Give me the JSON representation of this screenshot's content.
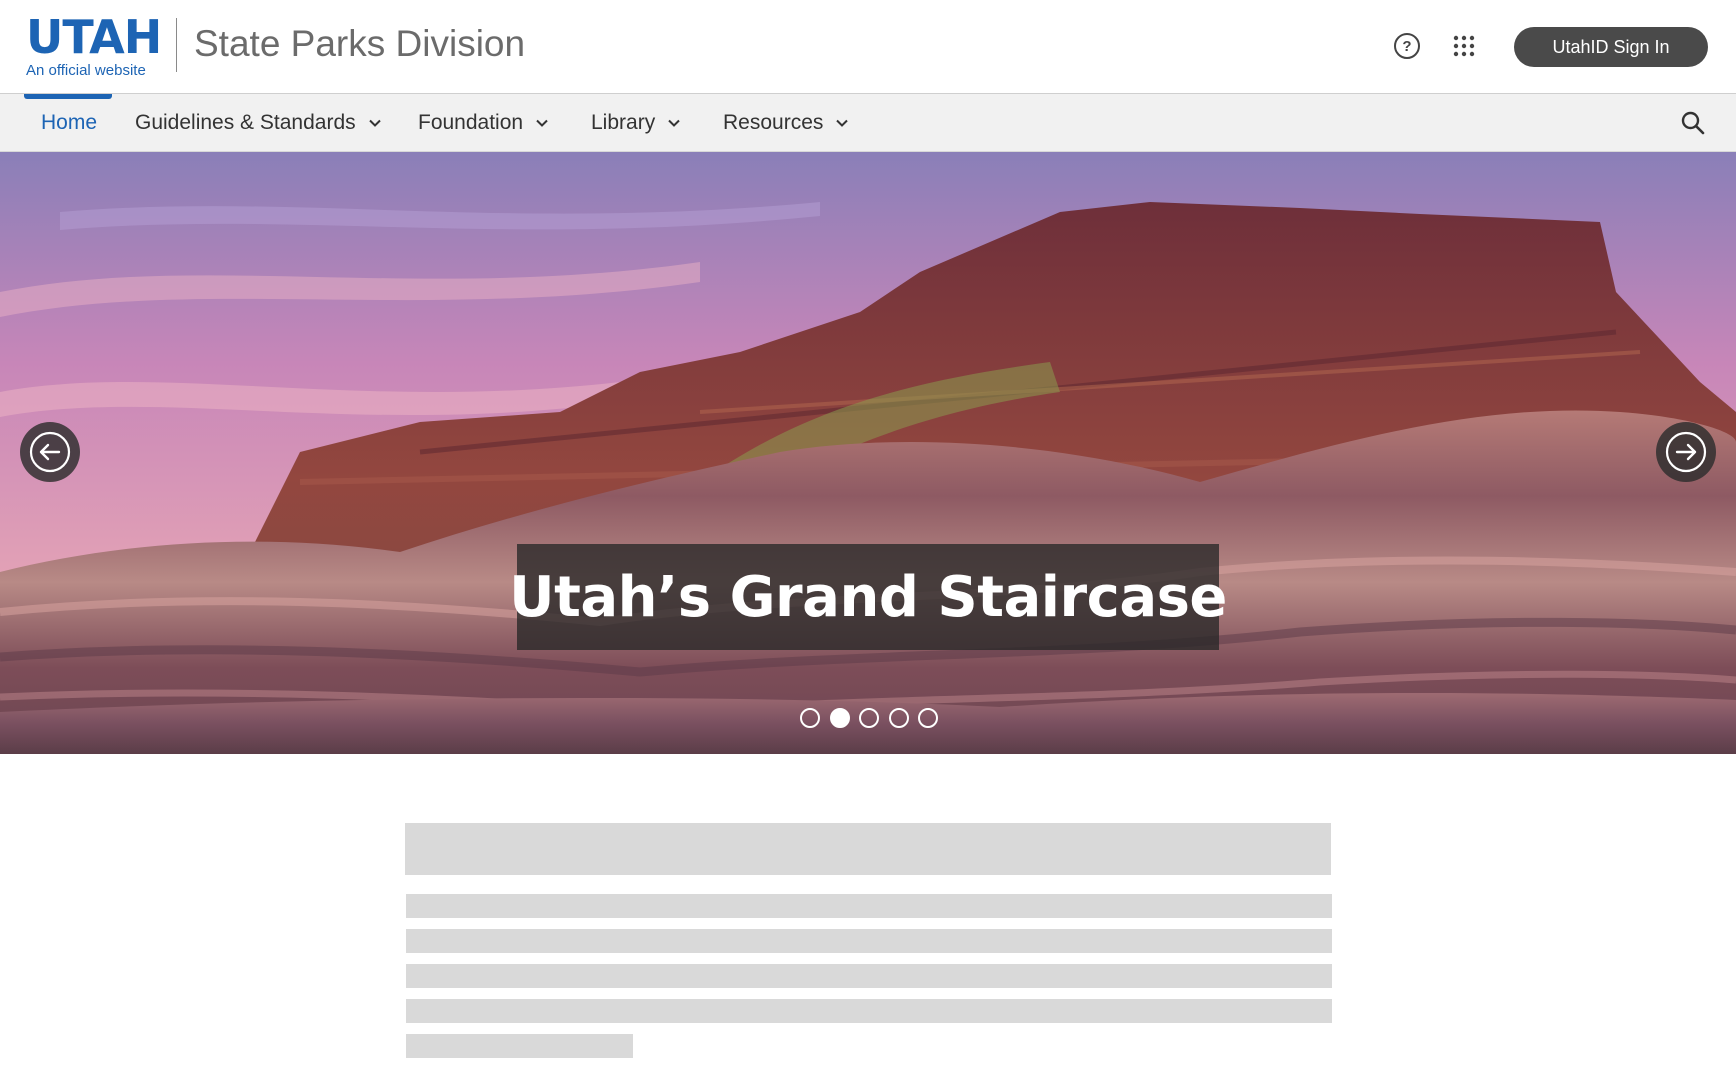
{
  "header": {
    "logo_text": "UTAH",
    "logo_subtitle": "An official website",
    "site_title": "State Parks Division",
    "help_icon": "help-circle-icon",
    "apps_icon": "apps-grid-icon",
    "signin_label": "UtahID Sign In"
  },
  "nav": {
    "items": [
      {
        "label": "Home",
        "active": true,
        "has_dropdown": false
      },
      {
        "label": "Guidelines & Standards",
        "active": false,
        "has_dropdown": true
      },
      {
        "label": "Foundation",
        "active": false,
        "has_dropdown": true
      },
      {
        "label": "Library",
        "active": false,
        "has_dropdown": true
      },
      {
        "label": "Resources",
        "active": false,
        "has_dropdown": true
      }
    ],
    "search_icon": "search-icon"
  },
  "hero": {
    "caption": "Utah’s Grand Staircase",
    "slide_count": 5,
    "active_slide": 2,
    "prev_icon": "arrow-left-circle-icon",
    "next_icon": "arrow-right-circle-icon"
  },
  "colors": {
    "brand_blue": "#1d64b4",
    "nav_bg": "#f1f1f1",
    "button_dark": "#4a4a4a",
    "placeholder_gray": "#d9d9d9"
  }
}
